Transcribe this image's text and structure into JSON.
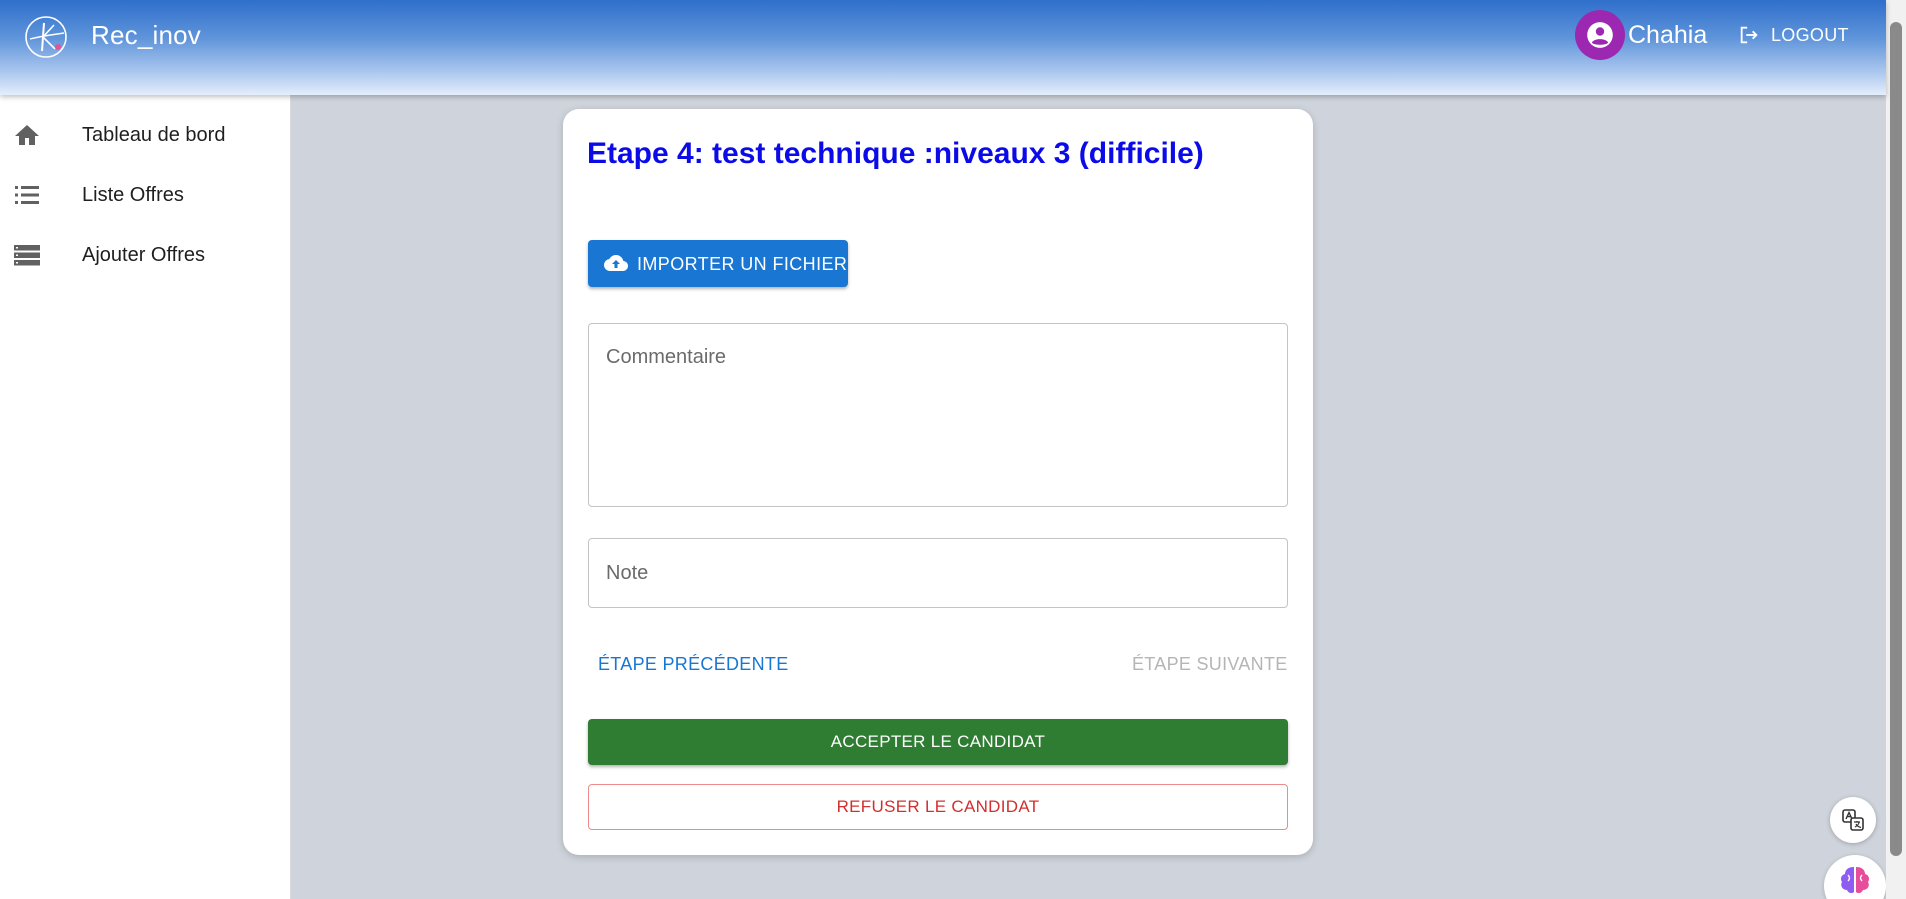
{
  "header": {
    "app_title": "Rec_inov",
    "user_name": "Chahia",
    "logout_label": "LOGOUT"
  },
  "sidebar": {
    "items": [
      {
        "label": "Tableau de bord",
        "icon": "home-icon"
      },
      {
        "label": "Liste Offres",
        "icon": "list-icon"
      },
      {
        "label": "Ajouter Offres",
        "icon": "storage-icon"
      }
    ]
  },
  "step": {
    "title": "Etape 4: test technique :niveaux 3 (difficile)",
    "upload_label": "IMPORTER UN FICHIER",
    "comment_placeholder": "Commentaire",
    "note_placeholder": "Note",
    "prev_label": "ÉTAPE PRÉCÉDENTE",
    "next_label": "ÉTAPE SUIVANTE",
    "accept_label": "ACCEPTER LE CANDIDAT",
    "reject_label": "REFUSER LE CANDIDAT"
  },
  "colors": {
    "primary": "#1976d2",
    "title": "#0b0be8",
    "accept": "#2e7d32",
    "reject": "#d32f2f",
    "avatar": "#9c27b0"
  }
}
